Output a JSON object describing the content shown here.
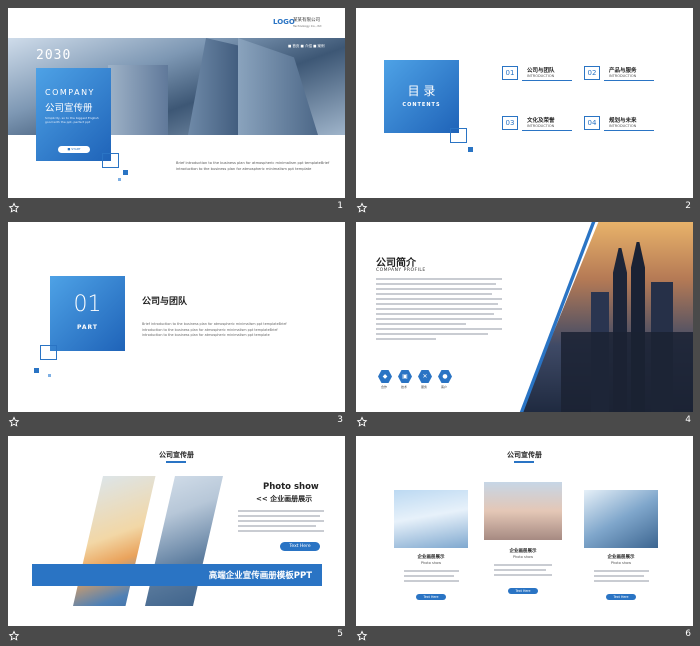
{
  "slides": [
    {
      "number": "1",
      "year": "2030",
      "logo": "LOGO",
      "company_name_cn": "某某有限公司",
      "company_name_en": "Technology Co., ltd",
      "nav": "■ 首页  ■ 介绍  ■ 案例",
      "title_en": "COMPANY",
      "title_cn": "公司宣传册",
      "desc": "Simplicity, so to the biggest English good with the ppt, perfect ppt",
      "button": "■ START",
      "body": "Brief introduction to the business plan for atmospheric minimalism ppt templateBrief introduction to the business plan for atmospheric minimalism ppt template"
    },
    {
      "number": "2",
      "heading_cn": "目 录",
      "heading_en": "CONTENTS",
      "items": [
        {
          "num": "01",
          "title": "公司与团队",
          "sub": "INTRODUCTION"
        },
        {
          "num": "02",
          "title": "产品与服务",
          "sub": "INTRODUCTION"
        },
        {
          "num": "03",
          "title": "文化及荣誉",
          "sub": "INTRODUCTION"
        },
        {
          "num": "04",
          "title": "规划与未来",
          "sub": "INTRODUCTION"
        }
      ]
    },
    {
      "number": "3",
      "part_num": "01",
      "part_label": "PART",
      "section_title": "公司与团队",
      "body": "Brief introduction to the business plan for atmospheric minimalism ppt templateBrief introduction to the business plan for atmospheric minimalism ppt templateBrief introduction to the business plan for atmospheric minimalism ppt template"
    },
    {
      "number": "4",
      "title_cn": "公司简介",
      "title_en": "COMPANY PROFILE",
      "icons": [
        {
          "name": "handshake-icon",
          "glyph": "◆",
          "label": "合作"
        },
        {
          "name": "monitor-icon",
          "glyph": "▣",
          "label": "技术"
        },
        {
          "name": "tools-icon",
          "glyph": "✕",
          "label": "服务"
        },
        {
          "name": "chat-icon",
          "glyph": "●",
          "label": "客户"
        }
      ]
    },
    {
      "number": "5",
      "title": "公司宣传册",
      "photo_show": "Photo show",
      "subtitle": "<< 企业画册展示",
      "button": "Text Here",
      "banner": "高端企业宣传画册模板PPT"
    },
    {
      "number": "6",
      "title": "公司宣传册",
      "cards": [
        {
          "title": "企业画册展示",
          "sub": "Photo show",
          "button": "Text Here"
        },
        {
          "title": "企业画册展示",
          "sub": "Photo show",
          "button": "Text Here"
        },
        {
          "title": "企业画册展示",
          "sub": "Photo show",
          "button": "Text Here"
        }
      ]
    }
  ],
  "colors": {
    "accent": "#2a74c4",
    "frame_bg": "#4a4a4a"
  }
}
